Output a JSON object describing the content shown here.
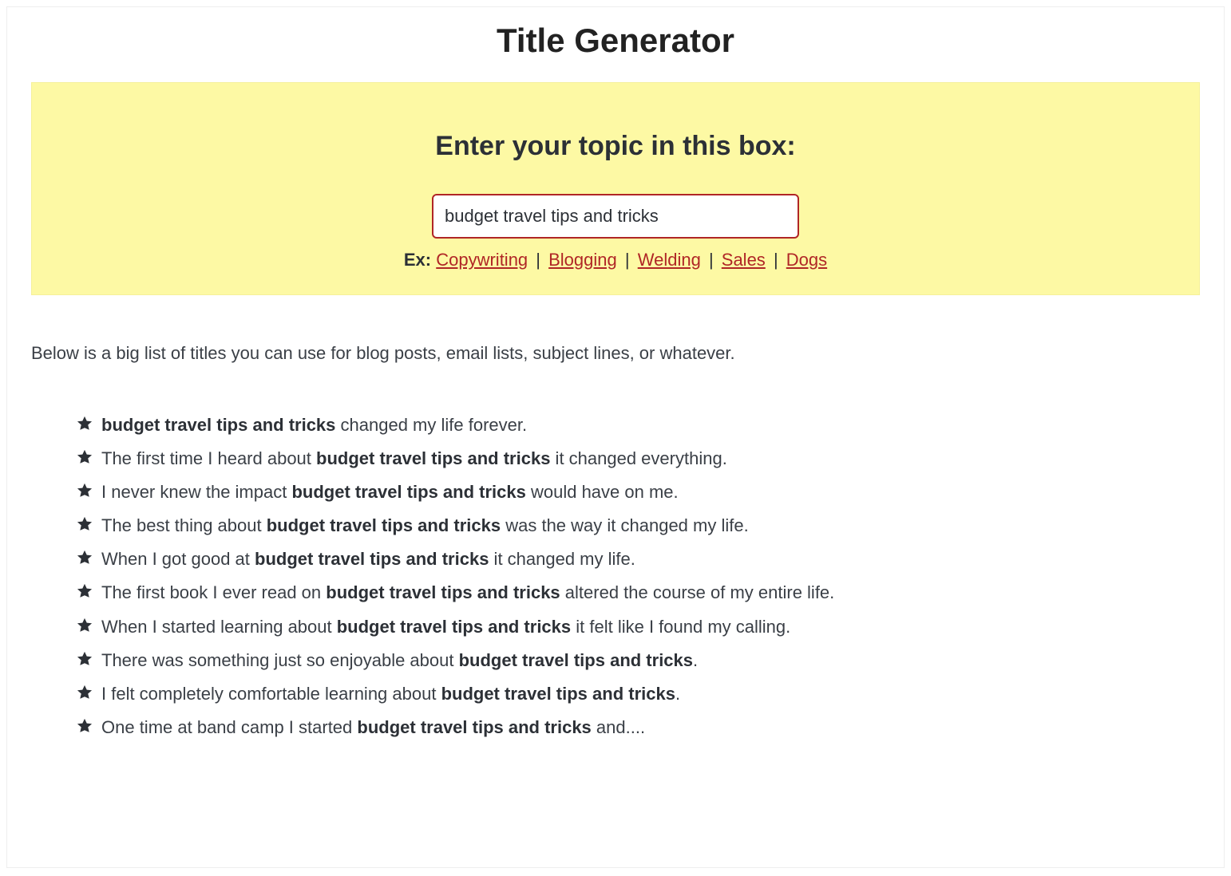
{
  "header": {
    "title": "Title Generator"
  },
  "topicBox": {
    "heading": "Enter your topic in this box:",
    "inputValue": "budget travel tips and tricks",
    "exLabel": "Ex:",
    "examples": [
      "Copywriting",
      "Blogging",
      "Welding",
      "Sales",
      "Dogs"
    ],
    "separator": " | "
  },
  "intro": "Below is a big list of titles you can use for blog posts, email lists, subject lines, or whatever.",
  "topic": "budget travel tips and tricks",
  "titles": [
    {
      "before": "",
      "after": " changed my life forever."
    },
    {
      "before": "The first time I heard about ",
      "after": " it changed everything."
    },
    {
      "before": "I never knew the impact ",
      "after": " would have on me."
    },
    {
      "before": "The best thing about ",
      "after": " was the way it changed my life."
    },
    {
      "before": "When I got good at ",
      "after": " it changed my life."
    },
    {
      "before": "The first book I ever read on ",
      "after": " altered the course of my entire life."
    },
    {
      "before": "When I started learning about ",
      "after": " it felt like I found my calling."
    },
    {
      "before": "There was something just so enjoyable about ",
      "after": "."
    },
    {
      "before": "I felt completely comfortable learning about ",
      "after": "."
    },
    {
      "before": "One time at band camp I started ",
      "after": " and...."
    }
  ]
}
